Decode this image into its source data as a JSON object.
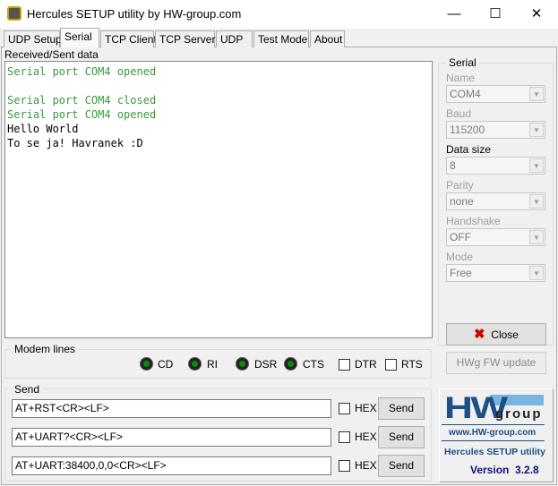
{
  "window": {
    "title": "Hercules SETUP utility by HW-group.com"
  },
  "tabs": [
    "UDP Setup",
    "Serial",
    "TCP Client",
    "TCP Server",
    "UDP",
    "Test Mode",
    "About"
  ],
  "received": {
    "label": "Received/Sent data",
    "lines": [
      {
        "text": "Serial port COM4 opened",
        "color": "green"
      },
      {
        "text": "",
        "color": "black"
      },
      {
        "text": "Serial port COM4 closed",
        "color": "green"
      },
      {
        "text": "Serial port COM4 opened",
        "color": "green"
      },
      {
        "text": "Hello World",
        "color": "black"
      },
      {
        "text": "To se ja! Havranek :D",
        "color": "black"
      }
    ]
  },
  "serial": {
    "label": "Serial",
    "fields": [
      {
        "label": "Name",
        "value": "COM4"
      },
      {
        "label": "Baud",
        "value": "115200"
      },
      {
        "label": "Data size",
        "value": "8"
      },
      {
        "label": "Parity",
        "value": "none"
      },
      {
        "label": "Handshake",
        "value": "OFF"
      },
      {
        "label": "Mode",
        "value": "Free"
      }
    ],
    "close_label": "Close",
    "fw_label": "HWg FW update"
  },
  "modem": {
    "label": "Modem lines",
    "leds": [
      "CD",
      "RI",
      "DSR",
      "CTS"
    ],
    "checks": [
      "DTR",
      "RTS"
    ]
  },
  "send": {
    "label": "Send",
    "rows": [
      {
        "value": "AT+RST<CR><LF>",
        "hex": "HEX",
        "button": "Send"
      },
      {
        "value": "AT+UART?<CR><LF>",
        "hex": "HEX",
        "button": "Send"
      },
      {
        "value": "AT+UART:38400,0,0<CR><LF>",
        "hex": "HEX",
        "button": "Send"
      }
    ]
  },
  "logo": {
    "hw": "HW",
    "group": "group",
    "url": "www.HW-group.com",
    "product": "Hercules SETUP utility",
    "version": "Version  3.2.8"
  }
}
